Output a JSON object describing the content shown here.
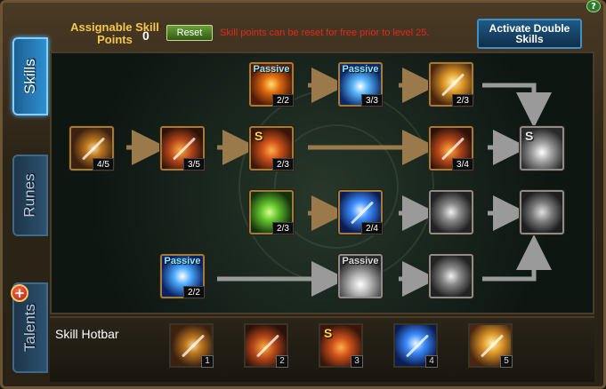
{
  "tabs": [
    {
      "label": "Skills",
      "active": true
    },
    {
      "label": "Runes",
      "active": false
    },
    {
      "label": "Talents",
      "active": false
    }
  ],
  "header": {
    "assignable_label": "Assignable Skill Points",
    "assignable_value": "0",
    "reset_label": "Reset",
    "reset_note": "Skill points can be reset for free prior to level 25.",
    "activate_label": "Activate Double Skills"
  },
  "nodes": {
    "r1c1": {
      "level": "4/5",
      "icon": "spear-icon"
    },
    "r1c2": {
      "level": "3/5",
      "icon": "arrow-volley-icon"
    },
    "r1c3": {
      "level": "2/3",
      "icon": "fire-swirl-icon",
      "badge": "S"
    },
    "r0c3": {
      "level": "2/2",
      "icon": "fire-burst-icon",
      "passive": "Passive"
    },
    "r0c4": {
      "level": "3/3",
      "icon": "ice-flare-icon",
      "passive": "Passive"
    },
    "r0c5": {
      "level": "2/3",
      "icon": "golden-spear-icon"
    },
    "r1c5": {
      "level": "3/4",
      "icon": "flaming-arrows-icon"
    },
    "r1c6": {
      "icon": "gray-shockwave-icon",
      "badge": "S"
    },
    "r2c3": {
      "level": "2/3",
      "icon": "poison-icon"
    },
    "r2c4": {
      "level": "2/4",
      "icon": "ice-spear-icon"
    },
    "r2c5": {
      "icon": "gray-lightning-icon"
    },
    "r2c6": {
      "icon": "gray-rune-icon"
    },
    "r3c2": {
      "level": "2/2",
      "icon": "blue-flare-icon",
      "passive": "Passive"
    },
    "r3c4": {
      "icon": "gray-explosion-icon",
      "passive": "Passive"
    },
    "r3c5": {
      "icon": "gray-vortex-icon"
    }
  },
  "hotbar": {
    "label": "Skill Hotbar",
    "slots": [
      {
        "num": "1",
        "icon": "spear-icon"
      },
      {
        "num": "2",
        "icon": "arrow-volley-icon"
      },
      {
        "num": "3",
        "icon": "fire-swirl-icon",
        "badge": "S"
      },
      {
        "num": "4",
        "icon": "ice-spear-icon"
      },
      {
        "num": "5",
        "icon": "golden-spear-icon"
      }
    ]
  },
  "colors": {
    "gold_text": "#f5c64a",
    "reset_note": "#e0281c",
    "tab_active": "#2f8fd0",
    "node_border": "#a07b3a"
  }
}
